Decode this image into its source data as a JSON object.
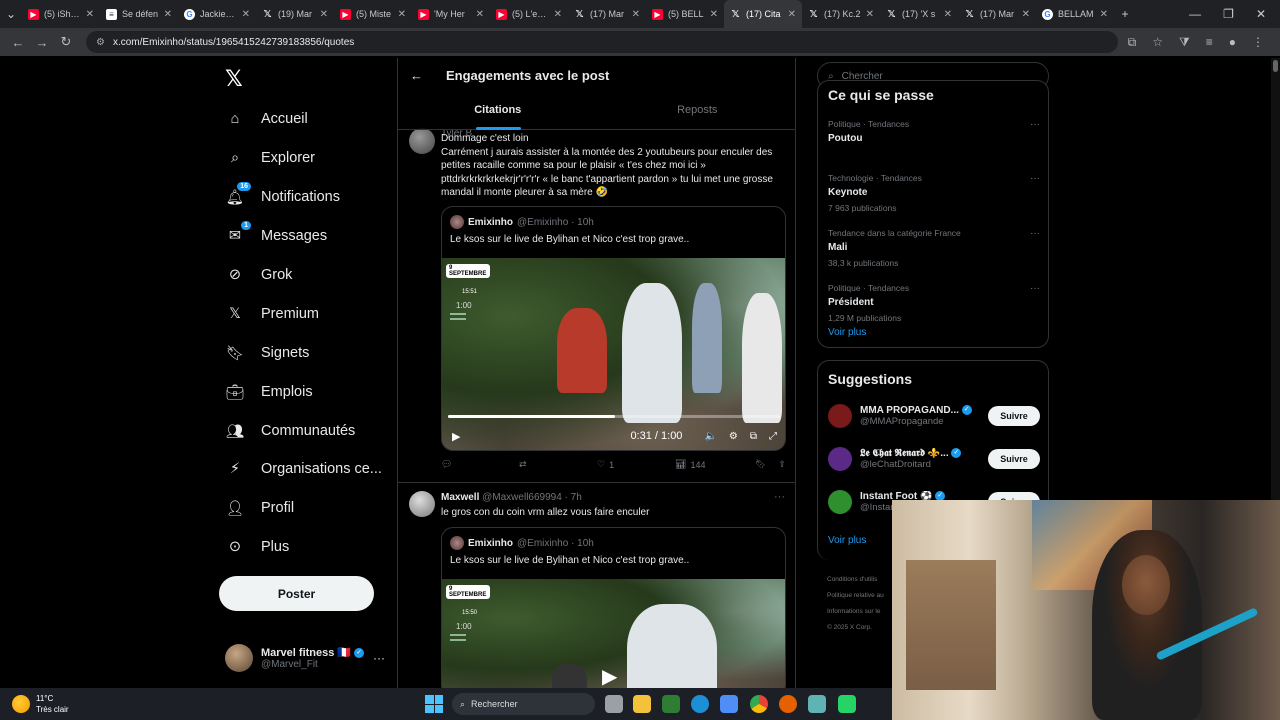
{
  "browser": {
    "tabs": [
      {
        "label": "(5) iShow",
        "fav": "yt"
      },
      {
        "label": "Se défen",
        "fav": "doc"
      },
      {
        "label": "Jackie Br",
        "fav": "go"
      },
      {
        "label": "(19) Mar",
        "fav": "xx"
      },
      {
        "label": "(5) Miste",
        "fav": "yt"
      },
      {
        "label": "'My Her",
        "fav": "yt"
      },
      {
        "label": "(5) L'emp",
        "fav": "yt"
      },
      {
        "label": "(17) Mar",
        "fav": "xx"
      },
      {
        "label": "(5) BELL",
        "fav": "yt"
      },
      {
        "label": "(17) Cita",
        "fav": "xx",
        "active": true
      },
      {
        "label": "(17) Kc.2",
        "fav": "xx"
      },
      {
        "label": "(17) 'X s",
        "fav": "xx"
      },
      {
        "label": "(17) Mar",
        "fav": "xx"
      },
      {
        "label": "BELLAM",
        "fav": "go"
      }
    ],
    "url": "x.com/Emixinho/status/1965415242739183856/quotes"
  },
  "nav": {
    "items": [
      {
        "label": "Accueil",
        "icon": "home-icon"
      },
      {
        "label": "Explorer",
        "icon": "search-icon"
      },
      {
        "label": "Notifications",
        "icon": "bell-icon",
        "badge": "16"
      },
      {
        "label": "Messages",
        "icon": "mail-icon",
        "badge": "1"
      },
      {
        "label": "Grok",
        "icon": "grok-icon"
      },
      {
        "label": "Premium",
        "icon": "x-logo-icon"
      },
      {
        "label": "Signets",
        "icon": "bookmark-icon"
      },
      {
        "label": "Emplois",
        "icon": "briefcase-icon"
      },
      {
        "label": "Communautés",
        "icon": "people-icon"
      },
      {
        "label": "Organisations ce...",
        "icon": "bolt-icon"
      },
      {
        "label": "Profil",
        "icon": "person-icon"
      },
      {
        "label": "Plus",
        "icon": "more-circle-icon"
      }
    ],
    "post_button": "Poster",
    "account": {
      "name": "Marvel fitness 🇫🇷",
      "handle": "@Marvel_Fit"
    }
  },
  "header": {
    "title": "Engagements avec le post",
    "tabs": [
      "Citations",
      "Reposts"
    ]
  },
  "posts": [
    {
      "partial_name": "Tyler B",
      "text": "Dommage c'est loin\nCarrément j aurais assister à la montée des 2 youtubeurs pour enculer des petites racaille comme sa pour le plaisir « t'es chez moi ici » pttdrkrkrkrkrkekrjr'r'r'r'r « le banc t'appartient pardon » tu lui met une grosse mandal il monte pleurer à sa mère 🤣",
      "quote": {
        "name": "Emixinho",
        "handle": "@Emixinho · 10h",
        "text": "Le ksos sur le live de Bylihan et Nico c'est trop grave..",
        "video": {
          "date": "9 SEPTEMBRE",
          "clock": "15:51",
          "score": "1:00",
          "time": "0:31 / 1:00",
          "progress": 0.5
        }
      },
      "stats": {
        "replies": "",
        "reposts": "",
        "likes": "1",
        "views": "144"
      }
    },
    {
      "name": "Maxwell",
      "handle": "@Maxwell669994 · 7h",
      "text": "le gros con du coin vrm allez vous faire enculer",
      "quote": {
        "name": "Emixinho",
        "handle": "@Emixinho · 10h",
        "text": "Le ksos sur le live de Bylihan et Nico c'est trop grave..",
        "video": {
          "date": "9 SEPTEMBRE",
          "clock": "15:50",
          "score": "1:00"
        }
      }
    }
  ],
  "right": {
    "search_placeholder": "Chercher",
    "trends_title": "Ce qui se passe",
    "trends": [
      {
        "category": "Politique · Tendances",
        "name": "Poutou",
        "count": ""
      },
      {
        "category": "Technologie · Tendances",
        "name": "Keynote",
        "count": "7 963 publications"
      },
      {
        "category": "Tendance dans la catégorie France",
        "name": "Mali",
        "count": "38,3 k publications"
      },
      {
        "category": "Politique · Tendances",
        "name": "Président",
        "count": "1,29 M publications"
      }
    ],
    "see_more": "Voir plus",
    "suggestions_title": "Suggestions",
    "suggestions": [
      {
        "name": "MMA PROPAGAND...",
        "handle": "@MMAPropagande",
        "button": "Suivre",
        "color": "#7a1a1a"
      },
      {
        "name": "𝕷𝖊 𝕮𝖍𝖆𝖙 𝕽𝖊𝖓𝖆𝖗𝖉 ⚜️...",
        "handle": "@leChatDroitard",
        "button": "Suivre",
        "color": "#5b2a86"
      },
      {
        "name": "Instant Foot ⚽",
        "handle": "@Instant",
        "button": "Suivre",
        "color": "#2f8f2f"
      }
    ],
    "footer": [
      "Conditions d'utilis",
      "Politique relative au",
      "Informations sur le",
      "© 2025 X Corp."
    ]
  },
  "taskbar": {
    "temp": "11°C",
    "weather": "Très clair",
    "search": "Rechercher"
  }
}
